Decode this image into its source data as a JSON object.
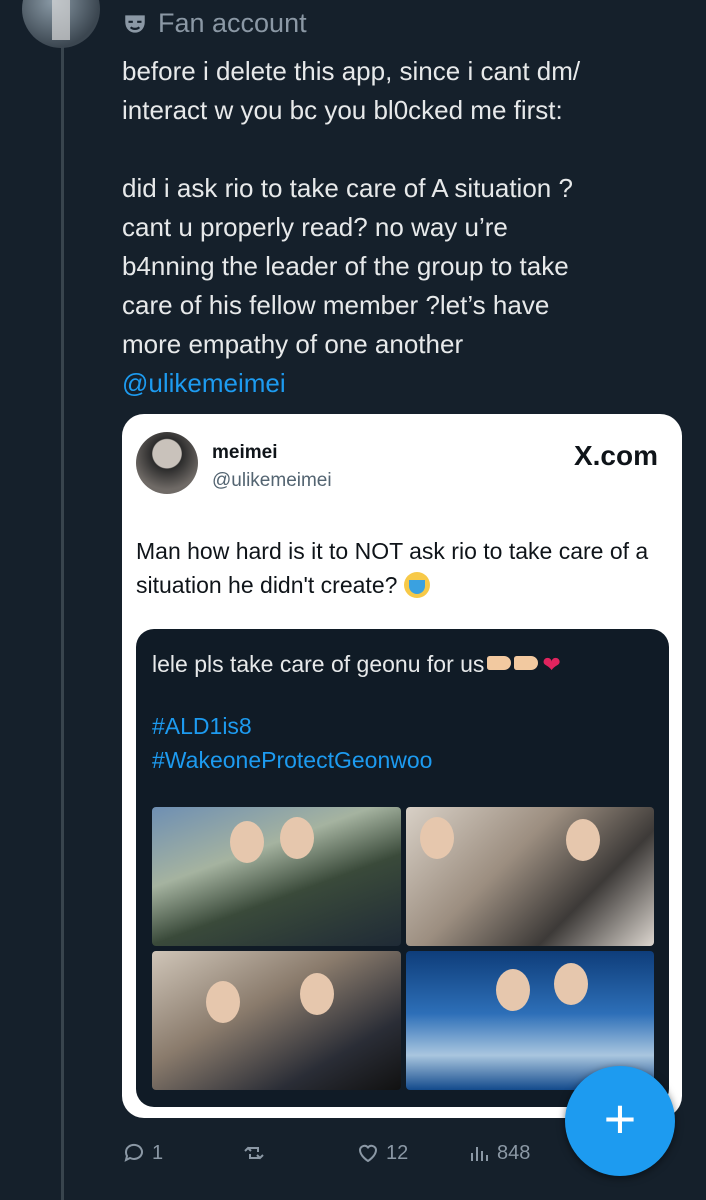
{
  "tweet": {
    "header_label": "Fan account",
    "lines": [
      "before i delete this app, since i cant dm/",
      "interact w you bc you bl0cked me first:",
      "did i ask rio to take care of A situation ?",
      "cant u properly read? no way u’re",
      "b4nning the leader of the group to take",
      "care of his fellow member ?let’s have",
      "more empathy of one another"
    ],
    "mention": "@ulikemeimei"
  },
  "quoted": {
    "name": "meimei",
    "handle": "@ulikemeimei",
    "brand": "X.com",
    "text": "Man how hard is it to NOT ask rio to take care of a situation he didn't create?",
    "inner": {
      "text": "lele pls take care of geonu for us",
      "hashtags": [
        "#ALD1is8",
        "#WakeoneProtectGeonwoo"
      ]
    }
  },
  "actions": {
    "replies": "1",
    "likes": "12",
    "views": "848"
  },
  "colors": {
    "background": "#15202b",
    "accent": "#1d9bf0"
  }
}
